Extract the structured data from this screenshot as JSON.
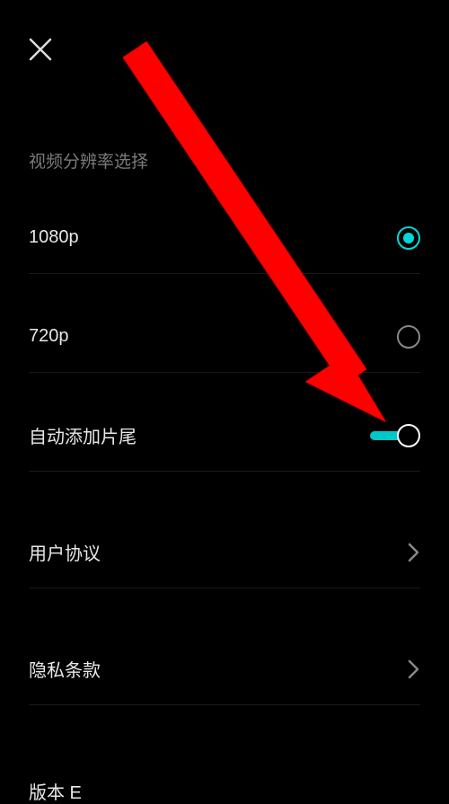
{
  "section_title": "视频分辨率选择",
  "options": {
    "opt1": {
      "label": "1080p",
      "selected": true
    },
    "opt2": {
      "label": "720p",
      "selected": false
    }
  },
  "auto_outro": {
    "label": "自动添加片尾",
    "on": true
  },
  "links": {
    "user_agreement": "用户协议",
    "privacy": "隐私条款"
  },
  "version_label_partial": "版本 E",
  "colors": {
    "accent": "#00d9d9",
    "arrow": "#ff0000"
  }
}
